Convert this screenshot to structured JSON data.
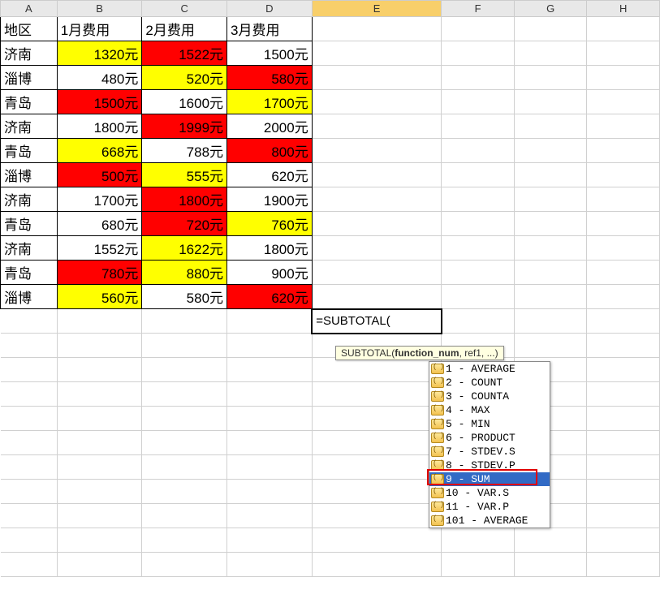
{
  "columns": [
    "A",
    "B",
    "C",
    "D",
    "E",
    "F",
    "G",
    "H"
  ],
  "headers": {
    "A": "地区",
    "B": "1月费用",
    "C": "2月费用",
    "D": "3月费用"
  },
  "rows": [
    {
      "A": "济南",
      "B": {
        "v": "1320元",
        "bg": "yellow"
      },
      "C": {
        "v": "1522元",
        "bg": "red"
      },
      "D": {
        "v": "1500元",
        "bg": "white"
      }
    },
    {
      "A": "淄博",
      "B": {
        "v": "480元",
        "bg": "white"
      },
      "C": {
        "v": "520元",
        "bg": "yellow"
      },
      "D": {
        "v": "580元",
        "bg": "red"
      }
    },
    {
      "A": "青岛",
      "B": {
        "v": "1500元",
        "bg": "red"
      },
      "C": {
        "v": "1600元",
        "bg": "white"
      },
      "D": {
        "v": "1700元",
        "bg": "yellow"
      }
    },
    {
      "A": "济南",
      "B": {
        "v": "1800元",
        "bg": "white"
      },
      "C": {
        "v": "1999元",
        "bg": "red"
      },
      "D": {
        "v": "2000元",
        "bg": "white"
      }
    },
    {
      "A": "青岛",
      "B": {
        "v": "668元",
        "bg": "yellow"
      },
      "C": {
        "v": "788元",
        "bg": "white"
      },
      "D": {
        "v": "800元",
        "bg": "red"
      }
    },
    {
      "A": "淄博",
      "B": {
        "v": "500元",
        "bg": "red"
      },
      "C": {
        "v": "555元",
        "bg": "yellow"
      },
      "D": {
        "v": "620元",
        "bg": "white"
      }
    },
    {
      "A": "济南",
      "B": {
        "v": "1700元",
        "bg": "white"
      },
      "C": {
        "v": "1800元",
        "bg": "red"
      },
      "D": {
        "v": "1900元",
        "bg": "white"
      }
    },
    {
      "A": "青岛",
      "B": {
        "v": "680元",
        "bg": "white"
      },
      "C": {
        "v": "720元",
        "bg": "red"
      },
      "D": {
        "v": "760元",
        "bg": "yellow"
      }
    },
    {
      "A": "济南",
      "B": {
        "v": "1552元",
        "bg": "white"
      },
      "C": {
        "v": "1622元",
        "bg": "yellow"
      },
      "D": {
        "v": "1800元",
        "bg": "white"
      }
    },
    {
      "A": "青岛",
      "B": {
        "v": "780元",
        "bg": "red"
      },
      "C": {
        "v": "880元",
        "bg": "yellow"
      },
      "D": {
        "v": "900元",
        "bg": "white"
      }
    },
    {
      "A": "淄博",
      "B": {
        "v": "560元",
        "bg": "yellow"
      },
      "C": {
        "v": "580元",
        "bg": "white"
      },
      "D": {
        "v": "620元",
        "bg": "red"
      }
    }
  ],
  "formula_cell": "=SUBTOTAL(",
  "tooltip": {
    "fn": "SUBTOTAL(",
    "bold": "function_num",
    "rest": ", ref1, ...)"
  },
  "autocomplete": [
    "1 - AVERAGE",
    "2 - COUNT",
    "3 - COUNTA",
    "4 - MAX",
    "5 - MIN",
    "6 - PRODUCT",
    "7 - STDEV.S",
    "8 - STDEV.P",
    "9 - SUM",
    "10 - VAR.S",
    "11 - VAR.P",
    "101 - AVERAGE"
  ],
  "selected_index": 8
}
